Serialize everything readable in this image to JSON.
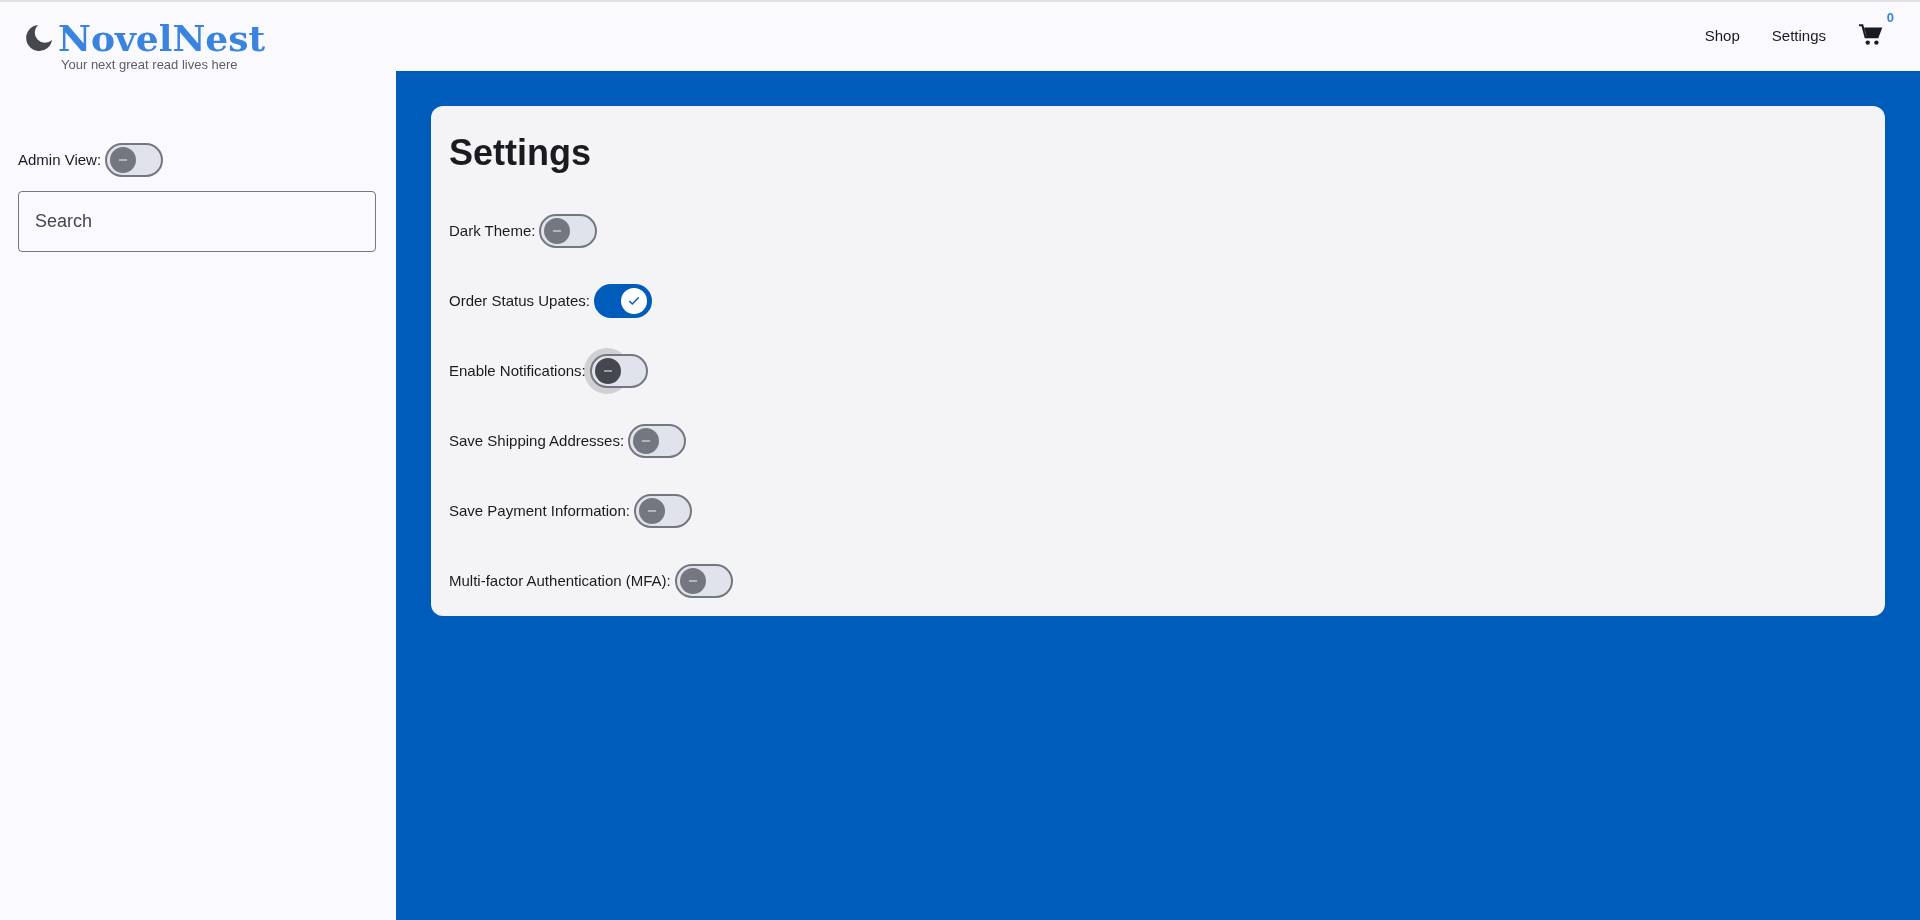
{
  "brand": {
    "name": "NovelNest",
    "tagline": "Your next great read lives here"
  },
  "nav": {
    "links": [
      {
        "label": "Shop",
        "selected": false
      },
      {
        "label": "Settings",
        "selected": false
      }
    ],
    "cart_count": "0"
  },
  "sidebar": {
    "admin_toggle": {
      "label": "Admin View:",
      "on": false
    },
    "search": {
      "placeholder": "Search"
    }
  },
  "settings": {
    "title": "Settings",
    "toggles": [
      {
        "label": "Dark Theme:",
        "on": false,
        "focused": false
      },
      {
        "label": "Order Status Upates:",
        "on": true,
        "focused": false
      },
      {
        "label": "Enable Notifications:",
        "on": false,
        "focused": true
      },
      {
        "label": "Save Shipping Addresses:",
        "on": false,
        "focused": false
      },
      {
        "label": "Save Payment Information:",
        "on": false,
        "focused": false
      },
      {
        "label": "Multi-factor Authentication (MFA):",
        "on": false,
        "focused": false
      }
    ]
  }
}
